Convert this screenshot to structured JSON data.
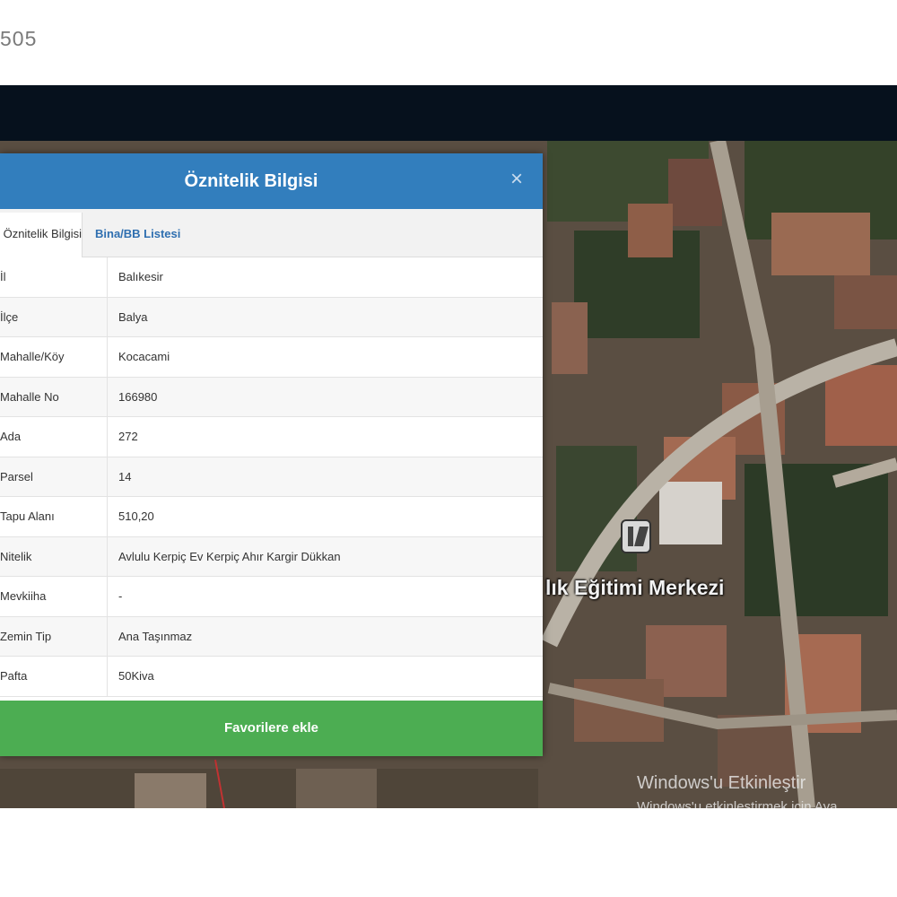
{
  "page_number": "505",
  "modal": {
    "title": "Öznitelik Bilgisi",
    "close_icon": "×",
    "tabs": [
      {
        "label": "Öznitelik Bilgisi",
        "active": true
      },
      {
        "label": "Bina/BB Listesi",
        "active": false
      }
    ],
    "rows": [
      {
        "key": "İl",
        "value": "Balıkesir"
      },
      {
        "key": "İlçe",
        "value": "Balya"
      },
      {
        "key": "Mahalle/Köy",
        "value": "Kocacami"
      },
      {
        "key": "Mahalle No",
        "value": "166980"
      },
      {
        "key": "Ada",
        "value": "272"
      },
      {
        "key": "Parsel",
        "value": "14"
      },
      {
        "key": "Tapu Alanı",
        "value": "510,20"
      },
      {
        "key": "Nitelik",
        "value": "Avlulu Kerpiç Ev Kerpiç Ahır Kargir Dükkan"
      },
      {
        "key": "Mevkiiha",
        "value": "-"
      },
      {
        "key": "Zemin Tip",
        "value": "Ana Taşınmaz"
      },
      {
        "key": "Pafta",
        "value": "50Kiva"
      }
    ],
    "favorite_button": "Favorilere ekle"
  },
  "map": {
    "place_label": "lık Eğitimi Merkezi"
  },
  "watermark": {
    "line1": "Windows'u Etkinleştir",
    "line2": "Windows'u etkinleştirmek için Aya"
  },
  "colors": {
    "header": "#327ebd",
    "button": "#4cad52",
    "topbar": "#06111d"
  }
}
